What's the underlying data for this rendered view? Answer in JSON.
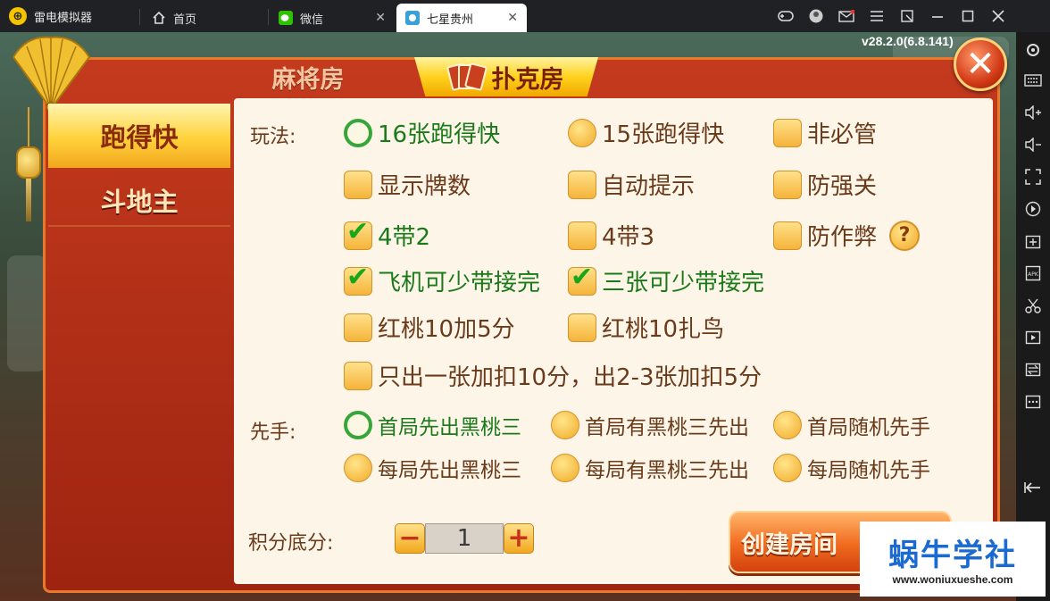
{
  "titlebar": {
    "brand": "雷电模拟器",
    "tabs": [
      {
        "label": "首页",
        "icon": "home-icon"
      },
      {
        "label": "微信",
        "icon": "wechat-icon"
      },
      {
        "label": "七星贵州",
        "icon": "game-icon"
      }
    ],
    "close_glyph": "✕"
  },
  "version": "v28.2.0(6.8.141)",
  "dialog": {
    "top_tabs": {
      "mahjong": "麻将房",
      "poker": "扑克房"
    },
    "side_tabs": {
      "active": "跑得快",
      "inactive": "斗地主"
    },
    "close_glyph": "✕",
    "play_label": "玩法:",
    "first_label": "先手:",
    "score_label": "积分底分:",
    "options": {
      "o1": "16张跑得快",
      "o2": "15张跑得快",
      "o3": "非必管",
      "o4": "显示牌数",
      "o5": "自动提示",
      "o6": "防强关",
      "o7": "4带2",
      "o8": "4带3",
      "o9": "防作弊",
      "o10": "飞机可少带接完",
      "o11": "三张可少带接完",
      "o12": "红桃10加5分",
      "o13": "红桃10扎鸟",
      "o14": "只出一张加扣10分，出2-3张加扣5分"
    },
    "first": {
      "f1": "首局先出黑桃三",
      "f2": "首局有黑桃三先出",
      "f3": "首局随机先手",
      "f4": "每局先出黑桃三",
      "f5": "每局有黑桃三先出",
      "f6": "每局随机先手"
    },
    "help_glyph": "?",
    "tick_glyph": "✔",
    "stepper": {
      "minus": "−",
      "value": "1",
      "plus": "+"
    },
    "create_button": "创建房间"
  },
  "watermark": {
    "title": "蜗牛学社",
    "url": "www.woniuxueshe.com"
  },
  "colors": {
    "checked_text": "#1a7a1a",
    "accent_gold": "#ffd21e",
    "frame_red": "#c43a1e"
  }
}
